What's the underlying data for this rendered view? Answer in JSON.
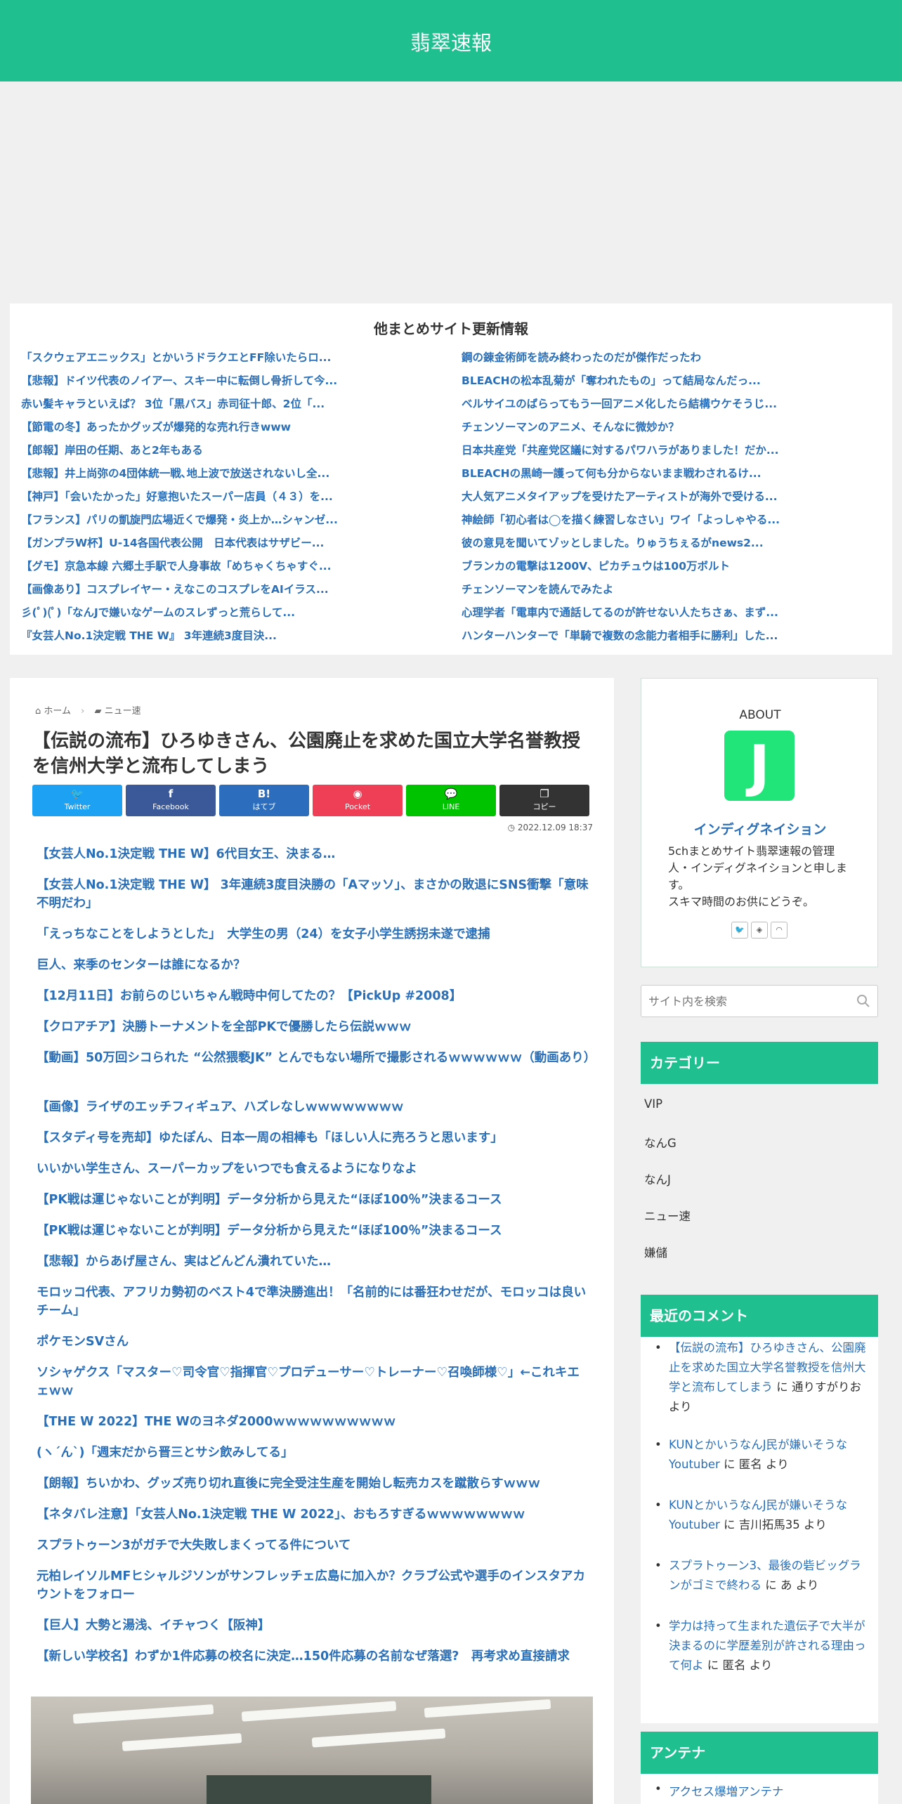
{
  "header": {
    "site_title": "翡翠速報"
  },
  "other_sites": {
    "title": "他まとめサイト更新情報",
    "left": [
      "「スクウェアエニックス」とかいうドラクエとFF除いたらロ...",
      "【悲報】ドイツ代表のノイアー、スキー中に転倒し骨折して今...",
      "赤い髪キャラといえば？ 3位「黒バス」赤司征十郎、2位「...",
      "【節電の冬】あったかグッズが爆発的な売れ行きwww",
      "【郎報】岸田の任期、あと2年もある",
      "【悲報】井上尚弥の4団体統一戦､地上波で放送されないし全...",
      "【神戸】「会いたかった」好意抱いたスーパー店員（４３）を...",
      "【フランス】パリの凱旋門広場近くで爆発・炎上か…シャンゼ...",
      "【ガンプラW杯】U-14各国代表公開　日本代表はサザビー...",
      "【グモ】京急本線 六郷土手駅で人身事故「めちゃくちゃすぐ...",
      "【画像あり】コスプレイヤー・えなこのコスプレをAIイラス...",
      "彡(ﾟ)(ﾟ)「なんJで嫌いなゲームのスレずっと荒らして...",
      "『女芸人No.1決定戦 THE W』 3年連続3度目決..."
    ],
    "right": [
      "鋼の錬金術師を読み終わったのだが傑作だったわ",
      "BLEACHの松本乱菊が「奪われたもの」って結局なんだっ...",
      "ベルサイユのばらってもう一回アニメ化したら結構ウケそうじ...",
      "チェンソーマンのアニメ、そんなに微妙か？",
      "日本共産党「共産党区議に対するパワハラがありました！だか...",
      "BLEACHの黒崎一護って何も分からないまま戦わされるけ...",
      "大人気アニメタイアップを受けたアーティストが海外で受ける...",
      "神絵師「初心者は◯を描く練習しなさい」ワイ「よっしゃやる...",
      "彼の意見を聞いてゾッとしました。りゅうちぇるがnews2...",
      "ブランカの電撃は1200V、ピカチュウは100万ボルト",
      "チェンソーマンを読んでみたよ",
      "心理学者「電車内で通話してるのが許せない人たちさぁ、まず...",
      "ハンターハンターで「単騎で複数の念能力者相手に勝利」した..."
    ]
  },
  "breadcrumb": {
    "home": "ホーム",
    "category": "ニュー速"
  },
  "article": {
    "title": "【伝説の流布】ひろゆきさん、公園廃止を求めた国立大学名誉教授を信州大学と流布してしまう",
    "date": "2022.12.09 18:37"
  },
  "share": {
    "buttons": [
      {
        "icon": "🐦",
        "label": "Twitter",
        "color": "#1da1f2"
      },
      {
        "icon": "f",
        "label": "Facebook",
        "color": "#3b5998"
      },
      {
        "icon": "B!",
        "label": "はてブ",
        "color": "#2c6ebd"
      },
      {
        "icon": "◉",
        "label": "Pocket",
        "color": "#ef3f56"
      },
      {
        "icon": "💬",
        "label": "LINE",
        "color": "#00c300"
      },
      {
        "icon": "❐",
        "label": "コピー",
        "color": "#333333"
      }
    ]
  },
  "link_list": [
    "【女芸人No.1決定戦 THE W】6代目女王、決まる…",
    "【女芸人No.1決定戦 THE W】 3年連続3度目決勝の「Aマッソ」、まさかの敗退にSNS衝撃「意味不明だわ」",
    "「えっちなことをしようとした」　大学生の男（24）を女子小学生誘拐未遂で逮捕",
    "巨人、来季のセンターは誰になるか？",
    "【12月11日】お前らのじいちゃん戦時中何してたの？【PickUp #2008】",
    "【クロアチア】決勝トーナメントを全部PKで優勝したら伝説ｗｗｗ",
    "【動画】50万回シコられた “公然猥褻JK” とんでもない場所で撮影されるｗｗｗｗｗｗ（動画あり）",
    "【画像】ライザのエッチフィギュア、ハズレなしｗｗｗｗｗｗｗｗ",
    "【スタディ号を売却】ゆたぽん、日本一周の相棒も「ほしい人に売ろうと思います」",
    "いいかい学生さん、スーパーカップをいつでも食えるようになりなよ",
    "【PK戦は運じゃないことが判明】データ分析から見えた“ほぼ100％”決まるコース",
    "【PK戦は運じゃないことが判明】データ分析から見えた“ほぼ100％”決まるコース",
    "【悲報】からあげ屋さん、実はどんどん潰れていた…",
    "モロッコ代表、アフリカ勢初のベスト4で準決勝進出！「名前的には番狂わせだが、モロッコは良いチーム」",
    "ポケモンSVさん",
    "ソシャゲクス「マスター♡司令官♡指揮官♡プロデューサー♡トレーナー♡召喚師様♡」←これキエェｗｗ",
    "【THE W 2022】THE Wのヨネダ2000ｗｗｗｗｗｗｗｗｗｗ",
    "(ヽ´ん`)「週末だから晋三とサシ飲みしてる」",
    "【朗報】ちいかわ、グッズ売り切れ直後に完全受注生産を開始し転売カスを蹴散らすｗｗｗ",
    "【ネタバレ注意】「女芸人No.1決定戦 THE W 2022」、おもろすぎるｗｗｗｗｗｗｗｗ",
    "スプラトゥーン3がガチで大失敗しまくってる件について",
    "元柏レイソルMFヒシャルジソンがサンフレッチェ広島に加入か？クラブ公式や選手のインスタアカウントをフォロー",
    "【巨人】大勢と湯浅、イチャつく【阪神】",
    "【新しい学校名】わずか1件応募の校名に決定…150件応募の名前なぜ落選?　再考求め直接請求"
  ],
  "about": {
    "heading": "ABOUT",
    "logo_letter": "J",
    "name": "インディグネイション",
    "desc": "5chまとめサイト翡翠速報の管理人・インディグネイションと申します。\nスキマ時間のお供にどうぞ。"
  },
  "search": {
    "placeholder": "サイト内を検索"
  },
  "categories": {
    "heading": "カテゴリー",
    "items": [
      "VIP",
      "なんG",
      "なんJ",
      "ニュー速",
      "嫌儲"
    ]
  },
  "recent_comments": {
    "heading": "最近のコメント",
    "items": [
      {
        "post": "【伝説の流布】ひろゆきさん、公園廃止を求めた国立大学名誉教授を信州大学と流布してしまう",
        "on": " に ",
        "author": "通りすがりお",
        "by": " より"
      },
      {
        "post": "KUNとかいうなんJ民が嫌いそうなYoutuber",
        "on": " に ",
        "author": "匿名",
        "by": " より"
      },
      {
        "post": "KUNとかいうなんJ民が嫌いそうなYoutuber",
        "on": " に ",
        "author": "吉川拓馬35",
        "by": " より"
      },
      {
        "post": "スプラトゥーン3、最後の砦ビッグランがゴミで終わる",
        "on": " に ",
        "author": "あ",
        "by": " より"
      },
      {
        "post": "学力は持って生まれた遺伝子で大半が決まるのに学歴差別が許される理由って何よ",
        "on": " に ",
        "author": "匿名",
        "by": " より"
      }
    ]
  },
  "antenna": {
    "heading": "アンテナ",
    "items": [
      "アクセス爆増アンテナ"
    ]
  }
}
